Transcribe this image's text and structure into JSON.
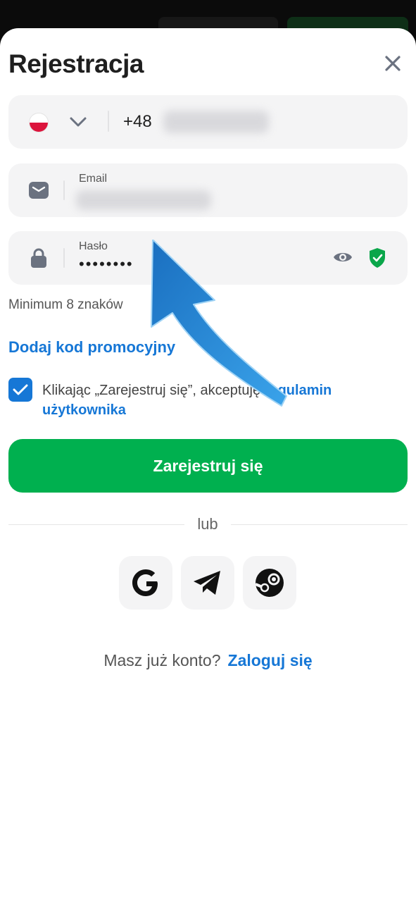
{
  "title": "Rejestracja",
  "phone": {
    "country": "PL",
    "prefix": "+48"
  },
  "email": {
    "label": "Email"
  },
  "password": {
    "label": "Hasło",
    "value": "••••••••",
    "hint": "Minimum 8 znaków"
  },
  "promo_link": "Dodaj kod promocyjny",
  "terms": {
    "text": "Klikając „Zarejestruj się”, akceptuję ",
    "link": "regulamin użytkownika",
    "checked": true
  },
  "register_button": "Zarejestruj się",
  "divider_text": "lub",
  "social": [
    "google-icon",
    "telegram-icon",
    "steam-icon"
  ],
  "login": {
    "prompt": "Masz już konto?",
    "link": "Zaloguj się"
  },
  "colors": {
    "accent": "#1677d6",
    "primary_button": "#00b04f",
    "field_bg": "#f4f4f5",
    "shield": "#0aa64a"
  }
}
